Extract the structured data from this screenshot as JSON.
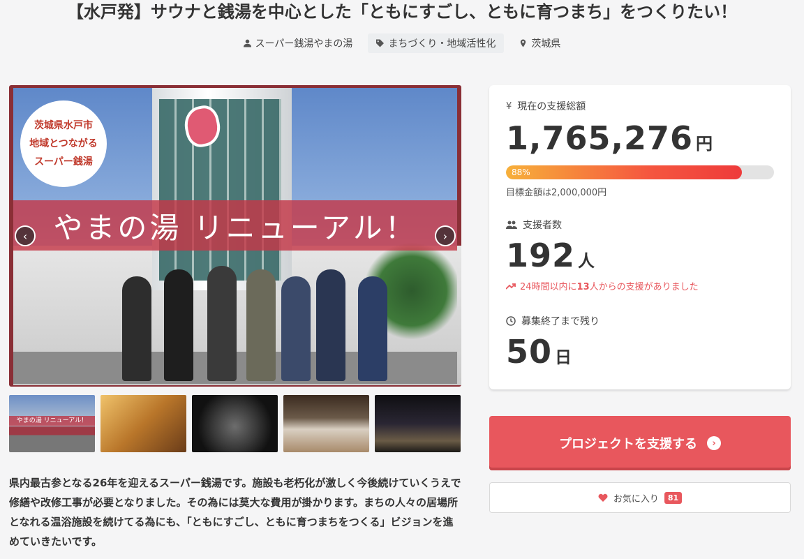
{
  "project": {
    "title": "【水戸発】サウナと銭湯を中心とした「ともにすごし、ともに育つまち」をつくりたい！",
    "owner": "スーパー銭湯やまの湯",
    "category": "まちづくり・地域活性化",
    "location": "茨城県"
  },
  "hero": {
    "badge_line1": "茨城県水戸市",
    "badge_line2": "地域とつながる",
    "badge_line3": "スーパー銭湯",
    "banner": "やまの湯 リニューアル！",
    "prev_label": "‹",
    "next_label": "›"
  },
  "thumbs": {
    "t1_banner": "やまの湯 リニューアル！"
  },
  "description": "県内最古参となる26年を迎えるスーパー銭湯です。施設も老朽化が激しく今後続けていくうえで修繕や改修工事が必要となりました。その為には莫大な費用が掛かります。まちの人々の居場所となれる温浴施設を続けてる為にも、「ともにすごし、ともに育つまちをつくる」ビジョンを進めていきたいです。",
  "stats": {
    "total_label": "現在の支援総額",
    "total_value": "1,765,276",
    "total_unit": "円",
    "progress_text": "88%",
    "progress_fraction": 0.88,
    "goal_text": "目標金額は2,000,000円",
    "supporters_label": "支援者数",
    "supporters_value": "192",
    "supporters_unit": "人",
    "trend_prefix": "24時間以内に",
    "trend_count": "13",
    "trend_suffix": "人からの支援がありました",
    "remaining_label": "募集終了まで残り",
    "remaining_value": "50",
    "remaining_unit": "日"
  },
  "actions": {
    "support_label": "プロジェクトを支援する",
    "favorite_label": "お気に入り",
    "favorite_count": "81"
  },
  "colors": {
    "accent": "#e8575d",
    "progress_start": "#f7b03a",
    "progress_end": "#ee3b3b"
  }
}
